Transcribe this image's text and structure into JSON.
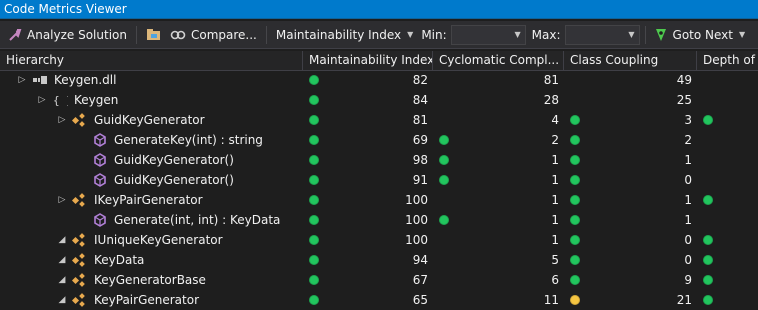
{
  "window": {
    "title": "Code Metrics Viewer"
  },
  "toolbar": {
    "analyze_label": "Analyze Solution",
    "compare_label": "Compare...",
    "metric_selected": "Maintainability Index",
    "min_label": "Min:",
    "min_value": "",
    "max_label": "Max:",
    "max_value": "",
    "goto_label": "Goto Next"
  },
  "columns": [
    "Hierarchy",
    "Maintainability Index",
    "Cyclomatic Compl...",
    "Class Coupling",
    "Depth of"
  ],
  "colors": {
    "green": "#22c55e",
    "yellow": "#f5c542",
    "accent": "#007acc"
  },
  "rows": [
    {
      "indent": 0,
      "expander": "closed",
      "icon": "assembly-icon",
      "name": "Keygen.dll",
      "mi": "82",
      "mi_status": "green",
      "cc": "81",
      "cc_status": "",
      "cp": "49",
      "cp_status": "",
      "dp": "",
      "dp_status": ""
    },
    {
      "indent": 1,
      "expander": "closed",
      "icon": "namespace-icon",
      "name": "Keygen",
      "mi": "84",
      "mi_status": "green",
      "cc": "28",
      "cc_status": "",
      "cp": "25",
      "cp_status": "",
      "dp": "",
      "dp_status": ""
    },
    {
      "indent": 2,
      "expander": "closed",
      "icon": "class-icon",
      "name": "GuidKeyGenerator",
      "mi": "81",
      "mi_status": "green",
      "cc": "4",
      "cc_status": "",
      "cp": "3",
      "cp_status": "green",
      "dp": "",
      "dp_status": "green"
    },
    {
      "indent": 3,
      "expander": "none",
      "icon": "method-icon",
      "name": "GenerateKey(int) : string",
      "mi": "69",
      "mi_status": "green",
      "cc": "2",
      "cc_status": "green",
      "cp": "2",
      "cp_status": "green",
      "dp": "",
      "dp_status": ""
    },
    {
      "indent": 3,
      "expander": "none",
      "icon": "method-icon",
      "name": "GuidKeyGenerator()",
      "mi": "98",
      "mi_status": "green",
      "cc": "1",
      "cc_status": "green",
      "cp": "1",
      "cp_status": "green",
      "dp": "",
      "dp_status": ""
    },
    {
      "indent": 3,
      "expander": "none",
      "icon": "method-icon",
      "name": "GuidKeyGenerator()",
      "mi": "91",
      "mi_status": "green",
      "cc": "1",
      "cc_status": "green",
      "cp": "0",
      "cp_status": "green",
      "dp": "",
      "dp_status": ""
    },
    {
      "indent": 2,
      "expander": "closed",
      "icon": "class-icon",
      "name": "IKeyPairGenerator",
      "mi": "100",
      "mi_status": "green",
      "cc": "1",
      "cc_status": "",
      "cp": "1",
      "cp_status": "green",
      "dp": "",
      "dp_status": "green"
    },
    {
      "indent": 3,
      "expander": "none",
      "icon": "method-icon",
      "name": "Generate(int, int) : KeyData",
      "mi": "100",
      "mi_status": "green",
      "cc": "1",
      "cc_status": "green",
      "cp": "1",
      "cp_status": "green",
      "dp": "",
      "dp_status": ""
    },
    {
      "indent": 2,
      "expander": "open",
      "icon": "class-icon",
      "name": "IUniqueKeyGenerator",
      "mi": "100",
      "mi_status": "green",
      "cc": "1",
      "cc_status": "",
      "cp": "0",
      "cp_status": "green",
      "dp": "",
      "dp_status": "green"
    },
    {
      "indent": 2,
      "expander": "open",
      "icon": "class-icon",
      "name": "KeyData",
      "mi": "94",
      "mi_status": "green",
      "cc": "5",
      "cc_status": "",
      "cp": "0",
      "cp_status": "green",
      "dp": "",
      "dp_status": "green"
    },
    {
      "indent": 2,
      "expander": "open",
      "icon": "class-icon",
      "name": "KeyGeneratorBase",
      "mi": "67",
      "mi_status": "green",
      "cc": "6",
      "cc_status": "",
      "cp": "9",
      "cp_status": "green",
      "dp": "",
      "dp_status": "green"
    },
    {
      "indent": 2,
      "expander": "open",
      "icon": "class-icon",
      "name": "KeyPairGenerator",
      "mi": "65",
      "mi_status": "green",
      "cc": "11",
      "cc_status": "",
      "cp": "21",
      "cp_status": "yellow",
      "dp": "",
      "dp_status": "green"
    }
  ]
}
